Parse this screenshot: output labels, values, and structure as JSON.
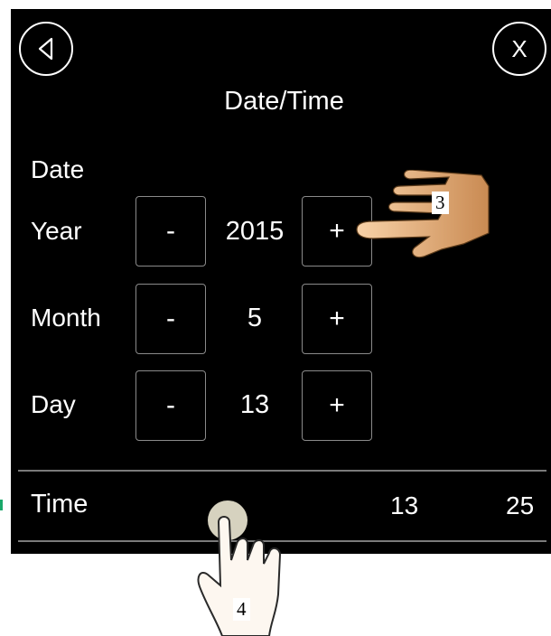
{
  "header": {
    "back_icon": "back-triangle-icon",
    "close_label": "X",
    "title": "Date/Time"
  },
  "date_section": {
    "label": "Date",
    "rows": [
      {
        "label": "Year",
        "minus": "-",
        "value": "2015",
        "plus": "+"
      },
      {
        "label": "Month",
        "minus": "-",
        "value": "5",
        "plus": "+"
      },
      {
        "label": "Day",
        "minus": "-",
        "value": "13",
        "plus": "+"
      }
    ]
  },
  "time_section": {
    "label": "Time",
    "hour": "13",
    "minute": "25"
  },
  "annotations": {
    "hand_top_step": "3",
    "hand_bottom_step": "4"
  },
  "colors": {
    "background": "#000000",
    "text": "#ffffff",
    "border": "#8a8a8a",
    "divider": "#7a7a7a",
    "touch_dot": "#d6d2bf",
    "hand_skin": "#f4c08a"
  }
}
